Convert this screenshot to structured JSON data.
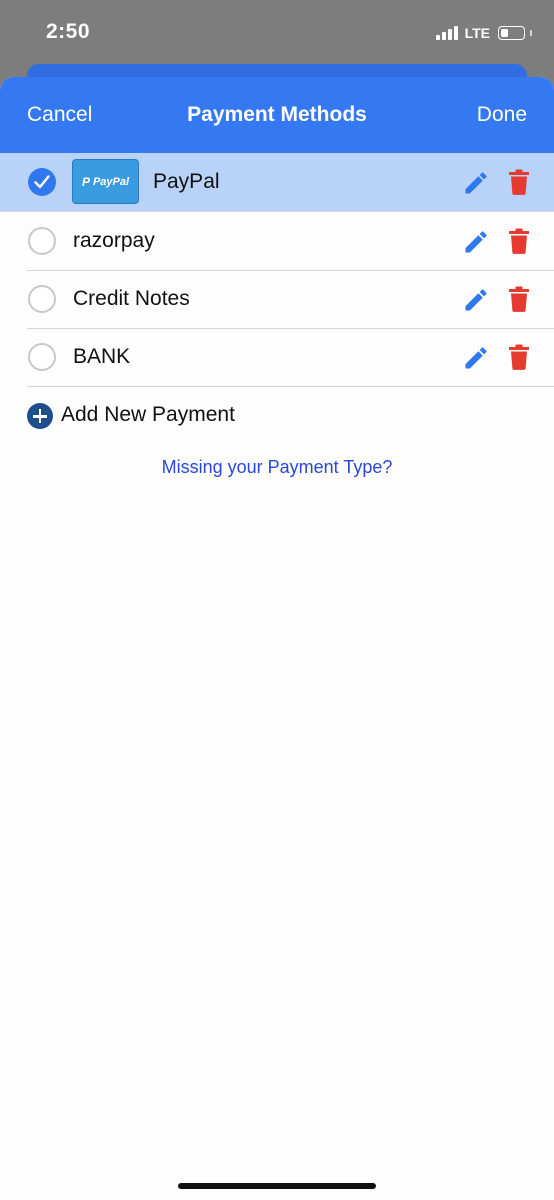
{
  "status_bar": {
    "time": "2:50",
    "network": "LTE",
    "battery_level": 0.35,
    "signal_bars": 4
  },
  "nav": {
    "cancel_label": "Cancel",
    "title": "Payment Methods",
    "done_label": "Done"
  },
  "payment_methods": [
    {
      "label": "PayPal",
      "selected": true,
      "logo_text": "PayPal",
      "logo_mark": "P"
    },
    {
      "label": "razorpay",
      "selected": false
    },
    {
      "label": "Credit Notes",
      "selected": false
    },
    {
      "label": "BANK",
      "selected": false
    }
  ],
  "add_payment_label": "Add New Payment",
  "missing_link_label": "Missing your Payment Type?",
  "colors": {
    "nav_background": "#3479f2",
    "selected_row": "#b8d2f8",
    "edit_icon": "#2f78f0",
    "delete_icon": "#e53a30",
    "link": "#2948d6",
    "add_icon": "#1f4e8c"
  },
  "icons": {
    "check": "check-icon",
    "edit": "pencil-icon",
    "delete": "trash-icon",
    "add": "plus-circle-icon"
  }
}
